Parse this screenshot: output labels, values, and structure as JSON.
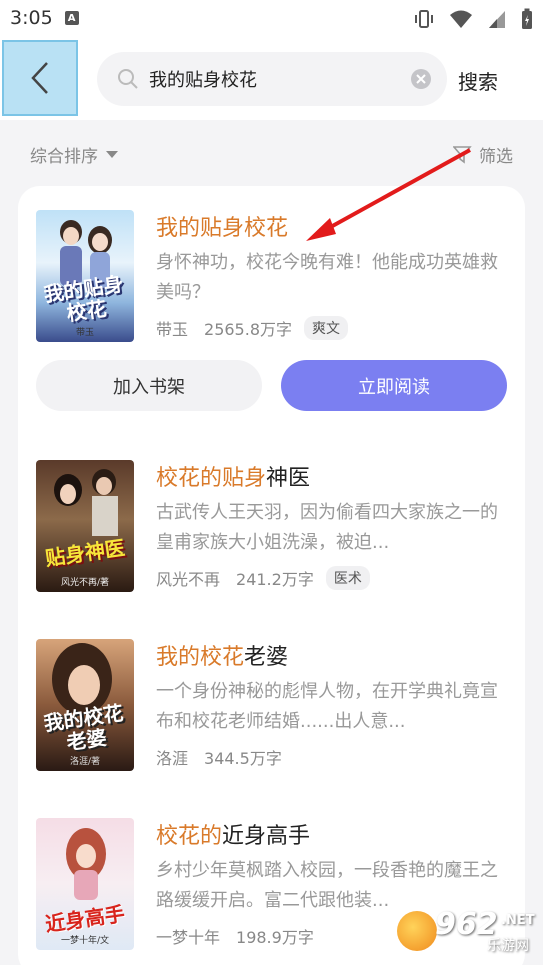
{
  "status": {
    "time": "3:05",
    "a_label": "A"
  },
  "search": {
    "query": "我的贴身校花",
    "button": "搜索"
  },
  "sortbar": {
    "sort_label": "综合排序",
    "filter_label": "筛选"
  },
  "books": [
    {
      "title_highlight": "我的贴身校花",
      "title_rest": "",
      "desc": "身怀神功，校花今晚有难！他能成功英雄救美吗？",
      "author": "带玉",
      "words": "2565.8万字",
      "tag": "爽文",
      "cover_text": "我的贴身校花",
      "cover_author": "带玉"
    },
    {
      "title_highlight": "校花的贴身",
      "title_rest": "神医",
      "desc": "古武传人王天羽，因为偷看四大家族之一的皇甫家族大小姐洗澡，被迫...",
      "author": "风光不再",
      "words": "241.2万字",
      "tag": "医术",
      "cover_text": "贴身神医",
      "cover_author": "风光不再/著"
    },
    {
      "title_highlight": "我的校花",
      "title_rest": "老婆",
      "desc": "一个身份神秘的彪悍人物，在开学典礼竟宣布和校花老师结婚......出人意...",
      "author": "洛涯",
      "words": "344.5万字",
      "tag": "",
      "cover_text": "我的校花老婆",
      "cover_author": "洛涯/著"
    },
    {
      "title_highlight": "校花的",
      "title_rest": "近身高手",
      "title_mid_highlight": "身",
      "desc": "乡村少年莫枫踏入校园，一段香艳的魔王之路缓缓开启。富二代跟他装...",
      "author": "一梦十年",
      "words": "198.9万字",
      "tag": "",
      "cover_text": "近身高手",
      "cover_author": "一梦十年/文"
    }
  ],
  "actions": {
    "add_shelf": "加入书架",
    "read_now": "立即阅读"
  },
  "watermark": {
    "num": "962",
    "net": ".NET",
    "sub": "乐游网"
  },
  "colors": {
    "accent": "#7b7ff1",
    "highlight": "#d97a2a"
  }
}
